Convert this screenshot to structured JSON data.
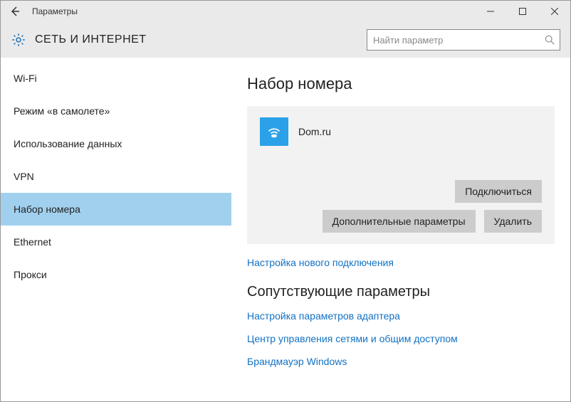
{
  "window": {
    "title": "Параметры"
  },
  "header": {
    "title": "СЕТЬ И ИНТЕРНЕТ"
  },
  "search": {
    "placeholder": "Найти параметр"
  },
  "sidebar": {
    "items": [
      {
        "label": "Wi-Fi"
      },
      {
        "label": "Режим «в самолете»"
      },
      {
        "label": "Использование данных"
      },
      {
        "label": "VPN"
      },
      {
        "label": "Набор номера"
      },
      {
        "label": "Ethernet"
      },
      {
        "label": "Прокси"
      }
    ]
  },
  "main": {
    "heading": "Набор номера",
    "connection": {
      "name": "Dom.ru"
    },
    "buttons": {
      "connect": "Подключиться",
      "advanced": "Дополнительные параметры",
      "delete": "Удалить"
    },
    "link_new": "Настройка нового подключения",
    "related_heading": "Сопутствующие параметры",
    "links": {
      "adapter": "Настройка параметров адаптера",
      "sharing": "Центр управления сетями и общим доступом",
      "firewall": "Брандмауэр Windows"
    }
  }
}
